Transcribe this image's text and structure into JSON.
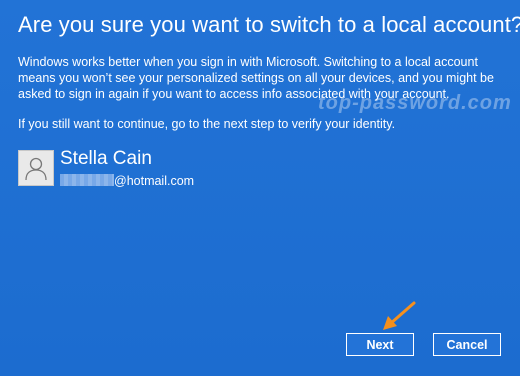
{
  "dialog": {
    "title": "Are you sure you want to switch to a local account?",
    "paragraph1": "Windows works better when you sign in with Microsoft. Switching to a local account means you won’t see your personalized settings on all your devices, and you might be asked to sign in again if you want to access info associated with your account.",
    "paragraph2": "If you still want to continue, go to the next step to verify your identity."
  },
  "watermark": "top-password.com",
  "account": {
    "name": "Stella Cain",
    "email_domain": "@hotmail.com",
    "avatar_icon": "person-icon"
  },
  "buttons": {
    "next_label": "Next",
    "cancel_label": "Cancel"
  },
  "colors": {
    "background": "#1f6fd0",
    "arrow": "#f5901e"
  }
}
